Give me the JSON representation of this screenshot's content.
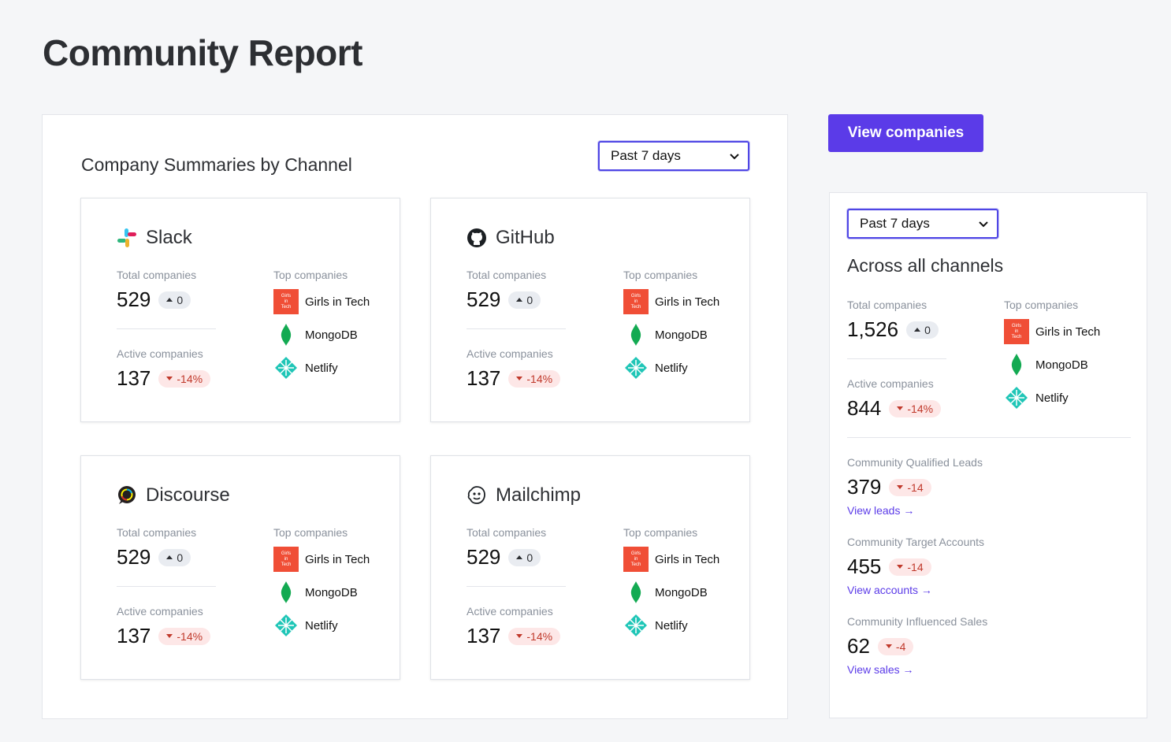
{
  "page": {
    "title": "Community Report"
  },
  "main_panel": {
    "title": "Company Summaries by Channel",
    "period": "Past 7 days"
  },
  "labels": {
    "total": "Total companies",
    "top": "Top companies",
    "active": "Active companies"
  },
  "companies": {
    "git": {
      "name": "Girls in Tech",
      "logo_text": "Girls in Tech"
    },
    "mongo": {
      "name": "MongoDB"
    },
    "netlify": {
      "name": "Netlify"
    }
  },
  "channels": [
    {
      "name": "Slack",
      "icon": "slack-icon",
      "total": "529",
      "total_change": "0",
      "active": "137",
      "active_change": "-14%"
    },
    {
      "name": "GitHub",
      "icon": "github-icon",
      "total": "529",
      "total_change": "0",
      "active": "137",
      "active_change": "-14%"
    },
    {
      "name": "Discourse",
      "icon": "discourse-icon",
      "total": "529",
      "total_change": "0",
      "active": "137",
      "active_change": "-14%"
    },
    {
      "name": "Mailchimp",
      "icon": "mailchimp-icon",
      "total": "529",
      "total_change": "0",
      "active": "137",
      "active_change": "-14%"
    }
  ],
  "view_companies_label": "View companies",
  "side_panel": {
    "period": "Past 7 days",
    "title": "Across all channels",
    "total": "1,526",
    "total_change": "0",
    "active": "844",
    "active_change": "-14%",
    "metrics": [
      {
        "label": "Community Qualified Leads",
        "value": "379",
        "change": "-14",
        "link": "View leads →"
      },
      {
        "label": "Community Target Accounts",
        "value": "455",
        "change": "-14",
        "link": "View accounts →"
      },
      {
        "label": "Community Influenced Sales",
        "value": "62",
        "change": "-4",
        "link": "View sales →"
      }
    ]
  },
  "colors": {
    "accent": "#5b3be8",
    "negative": "#c0392b",
    "negative_bg": "#fde7e7",
    "neutral_bg": "#e9ecf1"
  }
}
